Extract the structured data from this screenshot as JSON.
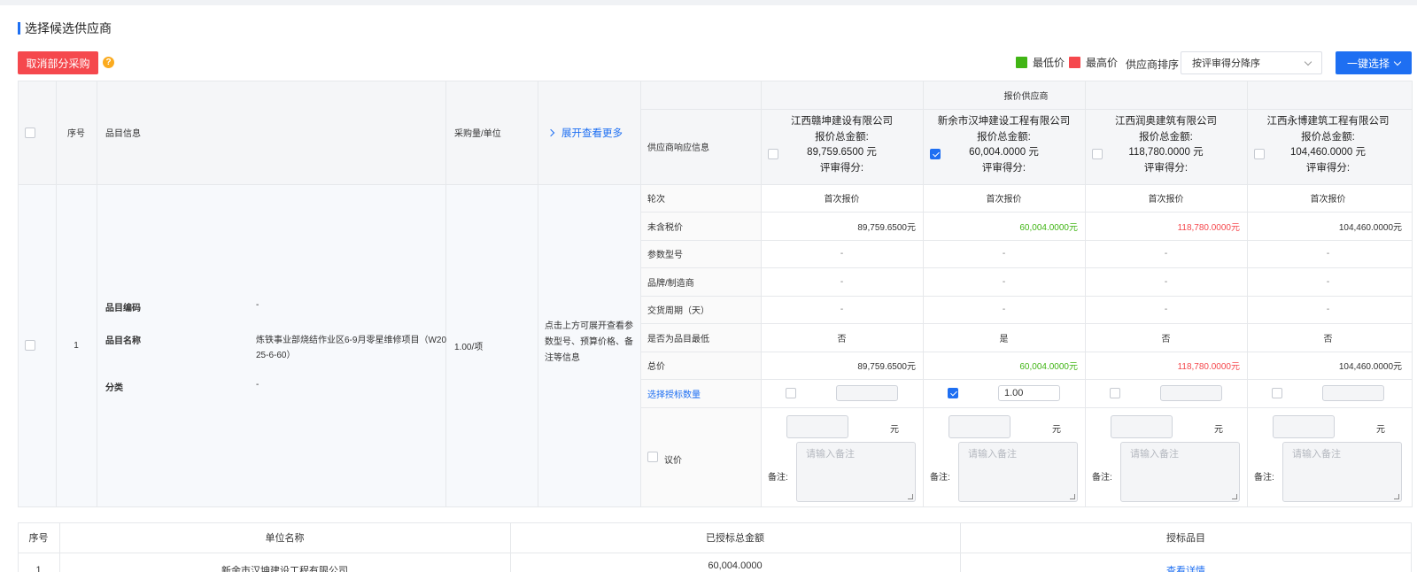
{
  "section_title": "选择候选供应商",
  "cancel_button": "取消部分采购",
  "help_icon": "?",
  "legend": {
    "lowest": "最低价",
    "highest": "最高价",
    "lowest_color": "#41b515",
    "highest_color": "#f5484d"
  },
  "sort": {
    "label": "供应商排序",
    "value": "按评审得分降序"
  },
  "select_all_button": "一键选择",
  "table": {
    "col_seq": "序号",
    "col_item": "品目信息",
    "col_qty": "采购量/单位",
    "expand_more": "展开查看更多",
    "col_resp": "供应商响应信息",
    "group_header": "报价供应商",
    "total_label": "报价总金额:",
    "score_label": "评审得分:",
    "suppliers": [
      {
        "name": "江西赣坤建设有限公司",
        "total": "89,759.6500 元",
        "checked": false
      },
      {
        "name": "新余市汉坤建设工程有限公司",
        "total": "60,004.0000 元",
        "checked": true
      },
      {
        "name": "江西润奥建筑有限公司",
        "total": "118,780.0000 元",
        "checked": false
      },
      {
        "name": "江西永博建筑工程有限公司",
        "total": "104,460.0000 元",
        "checked": false
      }
    ],
    "row": {
      "seq": "1",
      "code_label": "品目编码",
      "code_value": "-",
      "name_label": "品目名称",
      "name_value_1": "炼铁事业部烧结作业区6-9月零星维修项目（W20",
      "name_value_2": "25-6-60）",
      "cat_label": "分类",
      "cat_value": "-",
      "qty": "1.00/项",
      "hint_1": "点击上方可展开查看参",
      "hint_2": "数型号、预算价格、备",
      "hint_3": "注等信息"
    },
    "attrs": {
      "round": "轮次",
      "pre_tax": "未含税价",
      "model": "参数型号",
      "brand": "品牌/制造商",
      "delivery": "交货周期（天）",
      "is_lowest": "是否为品目最低",
      "total": "总价",
      "select_qty": "选择授标数量",
      "negotiate": "议价"
    },
    "values": [
      {
        "round": "首次报价",
        "pre_tax": "89,759.6500元",
        "model": "-",
        "brand": "-",
        "delivery": "-",
        "is_lowest": "否",
        "total": "89,759.6500元",
        "qty_checked": false,
        "qty": ""
      },
      {
        "round": "首次报价",
        "pre_tax": "60,004.0000元",
        "model": "-",
        "brand": "-",
        "delivery": "-",
        "is_lowest": "是",
        "total": "60,004.0000元",
        "qty_checked": true,
        "qty": "1.00"
      },
      {
        "round": "首次报价",
        "pre_tax": "118,780.0000元",
        "model": "-",
        "brand": "-",
        "delivery": "-",
        "is_lowest": "否",
        "total": "118,780.0000元",
        "qty_checked": false,
        "qty": ""
      },
      {
        "round": "首次报价",
        "pre_tax": "104,460.0000元",
        "model": "-",
        "brand": "-",
        "delivery": "-",
        "is_lowest": "否",
        "total": "104,460.0000元",
        "qty_checked": false,
        "qty": ""
      }
    ],
    "yuan": "元",
    "remark_label": "备注:",
    "remark_placeholder": "请输入备注"
  },
  "summary": {
    "col_seq": "序号",
    "col_name": "单位名称",
    "col_amount": "已授标总金额",
    "col_items": "授标品目",
    "row_seq": "1",
    "row_name": "新余市汉坤建设工程有限公司",
    "row_amount": "60,004.0000",
    "row_link": "查看详情"
  }
}
